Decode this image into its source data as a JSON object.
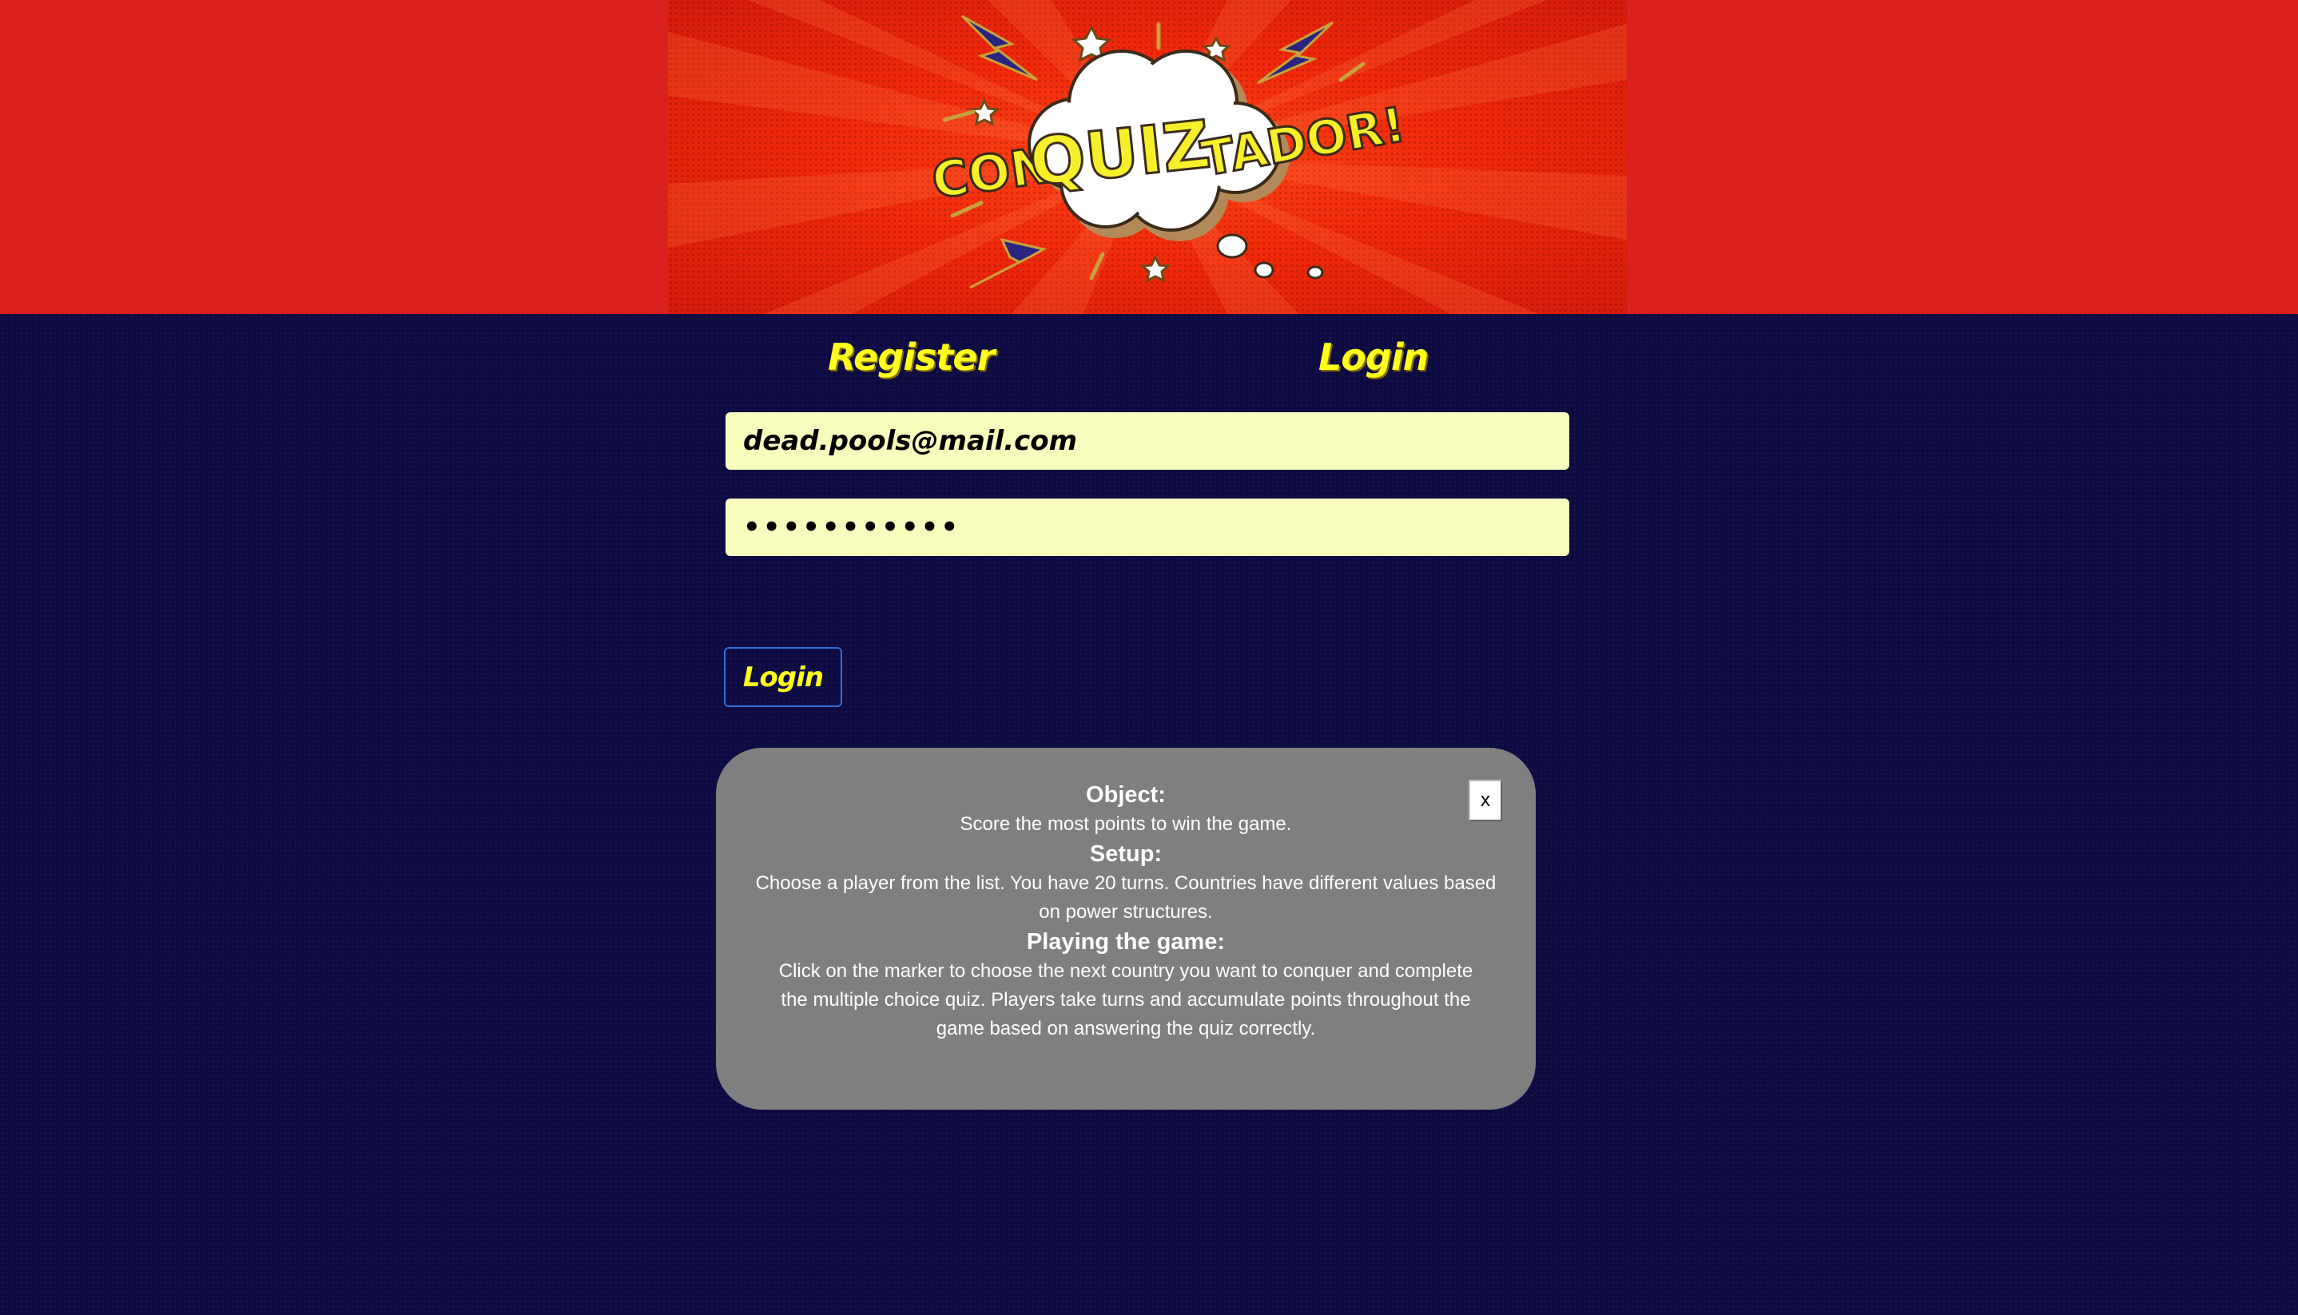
{
  "header": {
    "logo_text": "CONQUIZTADOR!",
    "logo_parts": [
      "CON",
      "QUIZ",
      "TADOR!"
    ]
  },
  "tabs": [
    {
      "label": "Register"
    },
    {
      "label": "Login"
    }
  ],
  "form": {
    "email_value": "dead.pools@mail.com",
    "password_value": "•••••••••••",
    "login_button_label": "Login"
  },
  "instructions": {
    "close_label": "x",
    "object_heading": "Object:",
    "object_text": "Score the most points to win the game.",
    "setup_heading": "Setup:",
    "setup_text": "Choose a player from the list. You have 20 turns. Countries have different values based on power structures.",
    "playing_heading": "Playing the game:",
    "playing_text": "Click on the marker to choose the next country you want to conquer and complete the multiple choice quiz. Players take turns and accumulate points throughout the game based on answering the quiz correctly."
  },
  "colors": {
    "header_red": "#dc1f1f",
    "page_navy": "#0d0b42",
    "accent_yellow": "#ffff1a",
    "input_bg": "#f8fcbd",
    "modal_gray": "#7f7f7f"
  }
}
